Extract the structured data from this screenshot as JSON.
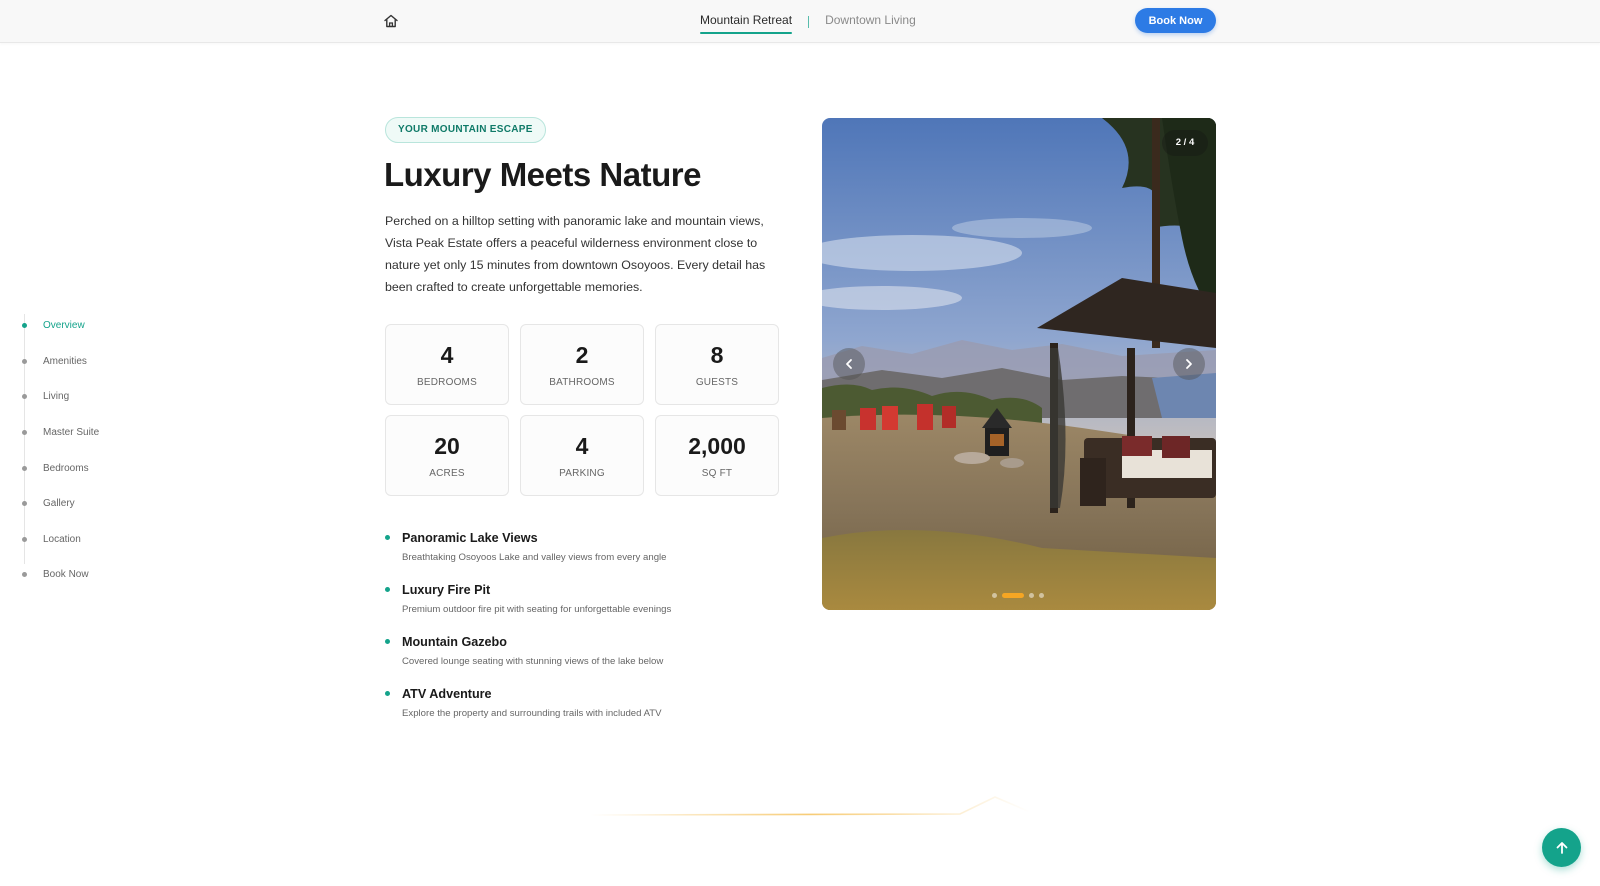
{
  "topnav": {
    "tabs": [
      {
        "label": "Mountain Retreat",
        "active": true
      },
      {
        "label": "Downtown Living",
        "active": false
      }
    ],
    "book_label": "Book Now",
    "accent": "#14a38b",
    "button_color": "#2d7be5"
  },
  "sidenav": {
    "items": [
      {
        "label": "Overview",
        "active": true
      },
      {
        "label": "Amenities"
      },
      {
        "label": "Living"
      },
      {
        "label": "Master Suite"
      },
      {
        "label": "Bedrooms"
      },
      {
        "label": "Gallery"
      },
      {
        "label": "Location"
      },
      {
        "label": "Book Now"
      }
    ]
  },
  "hero": {
    "badge": "YOUR MOUNTAIN ESCAPE",
    "title": "Luxury Meets Nature",
    "description": "Perched on a hilltop setting with panoramic lake and mountain views, Vista Peak Estate offers a peaceful wilderness environment close to nature yet only 15 minutes from downtown Osoyoos. Every detail has been crafted to create unforgettable memories."
  },
  "stats": [
    {
      "value": "4",
      "label": "BEDROOMS"
    },
    {
      "value": "2",
      "label": "BATHROOMS"
    },
    {
      "value": "8",
      "label": "GUESTS"
    },
    {
      "value": "20",
      "label": "ACRES"
    },
    {
      "value": "4",
      "label": "PARKING"
    },
    {
      "value": "2,000",
      "label": "SQ FT"
    }
  ],
  "features": [
    {
      "title": "Panoramic Lake Views",
      "desc": "Breathtaking Osoyoos Lake and valley views from every angle"
    },
    {
      "title": "Luxury Fire Pit",
      "desc": "Premium outdoor fire pit with seating for unforgettable evenings"
    },
    {
      "title": "Mountain Gazebo",
      "desc": "Covered lounge seating with stunning views of the lake below"
    },
    {
      "title": "ATV Adventure",
      "desc": "Explore the property and surrounding trails with included ATV"
    }
  ],
  "carousel": {
    "counter": "2 / 4",
    "current": 2,
    "total": 4,
    "active_dot_color": "#f5a623"
  },
  "icons": {
    "home": "home-icon",
    "prev": "chevron-left-icon",
    "next": "chevron-right-icon",
    "scroll_top": "arrow-up-icon"
  }
}
